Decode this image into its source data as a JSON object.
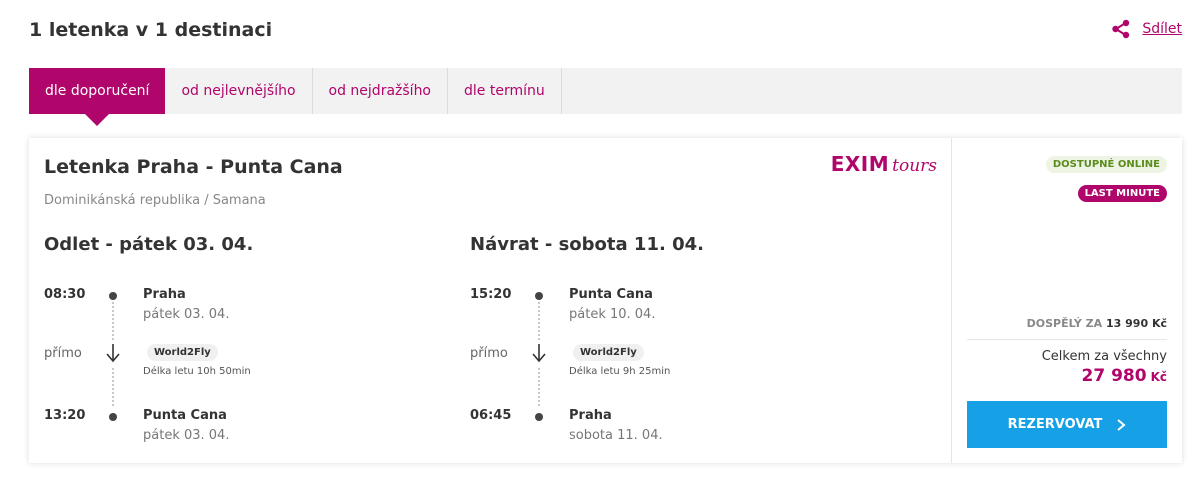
{
  "header": {
    "title": "1 letenka v 1 destinaci",
    "share_label": "Sdílet",
    "share_icon": "share-icon"
  },
  "tabs": [
    {
      "label": "dle doporučení",
      "active": true
    },
    {
      "label": "od nejlevnějšího",
      "active": false
    },
    {
      "label": "od nejdražšího",
      "active": false
    },
    {
      "label": "dle termínu",
      "active": false
    }
  ],
  "offer": {
    "title": "Letenka Praha - Punta Cana",
    "subtitle": "Dominikánská republika / Samana",
    "brand": {
      "main": "EXIM",
      "script": "tours"
    },
    "outbound": {
      "heading": "Odlet - pátek 03. 04.",
      "dep_time": "08:30",
      "dep_place": "Praha",
      "dep_date": "pátek 03. 04.",
      "direct": "přímo",
      "airline": "World2Fly",
      "duration": "Délka letu 10h 50min",
      "arr_time": "13:20",
      "arr_place": "Punta Cana",
      "arr_date": "pátek 03. 04."
    },
    "return": {
      "heading": "Návrat - sobota 11. 04.",
      "dep_time": "15:20",
      "dep_place": "Punta Cana",
      "dep_date": "pátek 10. 04.",
      "direct": "přímo",
      "airline": "World2Fly",
      "duration": "Délka letu 9h 25min",
      "arr_time": "06:45",
      "arr_place": "Praha",
      "arr_date": "sobota 11. 04."
    },
    "badges": {
      "online": "DOSTUPNÉ ONLINE",
      "last_minute": "LAST MINUTE"
    },
    "price": {
      "adult_label": "DOSPĚLÝ ZA",
      "adult_value": "13 990 Kč",
      "total_label": "Celkem za všechny",
      "total_value": "27 980",
      "currency": "Kč"
    },
    "reserve_label": "REZERVOVAT"
  },
  "colors": {
    "brand": "#b0056a",
    "button": "#16a1e7",
    "online_badge_text": "#5b8c1e"
  }
}
